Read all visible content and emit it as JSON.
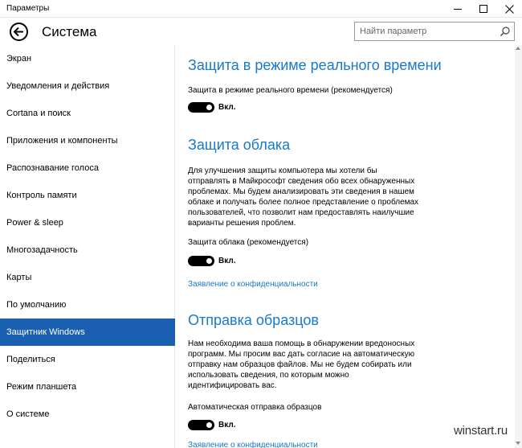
{
  "window": {
    "title": "Параметры",
    "minimize_icon": "minimize-icon",
    "maximize_icon": "maximize-icon",
    "close_icon": "close-icon"
  },
  "header": {
    "title": "Система",
    "back_icon": "back-arrow-icon",
    "search_placeholder": "Найти параметр",
    "search_value": "",
    "search_icon": "search-icon"
  },
  "sidebar": {
    "items": [
      {
        "label": "Экран"
      },
      {
        "label": "Уведомления и действия"
      },
      {
        "label": "Cortana и поиск"
      },
      {
        "label": "Приложения и компоненты"
      },
      {
        "label": "Распознавание голоса"
      },
      {
        "label": "Контроль памяти"
      },
      {
        "label": "Power & sleep"
      },
      {
        "label": "Многозадачность"
      },
      {
        "label": "Карты"
      },
      {
        "label": "По умолчанию"
      },
      {
        "label": "Защитник Windows"
      },
      {
        "label": "Поделиться"
      },
      {
        "label": "Режим планшета"
      },
      {
        "label": "О системе"
      }
    ],
    "active_index": 10,
    "active_color": "#1a5fb0"
  },
  "content": {
    "realtime": {
      "heading": "Защита в режиме реального времени",
      "setting_label": "Защита в режиме реального времени (рекомендуется)",
      "toggle_state": "Вкл.",
      "toggle_on": true
    },
    "cloud": {
      "heading": "Защита облака",
      "description": "Для улучшения защиты компьютера мы хотели бы отправлять в Майкрософт сведения обо всех обнаруженных проблемах. Мы будем анализировать эти сведения в нашем облаке и получать более полное представление о проблемах пользователей, что позволит нам предоставлять наилучшие варианты решения проблем.",
      "setting_label": "Защита облака (рекомендуется)",
      "toggle_state": "Вкл.",
      "toggle_on": true,
      "privacy_link": "Заявление о конфиденциальности"
    },
    "samples": {
      "heading": "Отправка образцов",
      "description": "Нам необходима ваша помощь в обнаружении вредоносных программ. Мы просим вас дать согласие на автоматическую отправку нам образцов файлов. Мы не будем собирать или использовать сведения, по которым можно идентифицировать вас.",
      "setting_label": "Автоматическая отправка образцов",
      "toggle_state": "Вкл.",
      "toggle_on": true,
      "privacy_link": "Заявление о конфиденциальности"
    }
  },
  "colors": {
    "accent": "#1979ca",
    "toggle_on": "#000000"
  },
  "watermark": "winstart.ru"
}
